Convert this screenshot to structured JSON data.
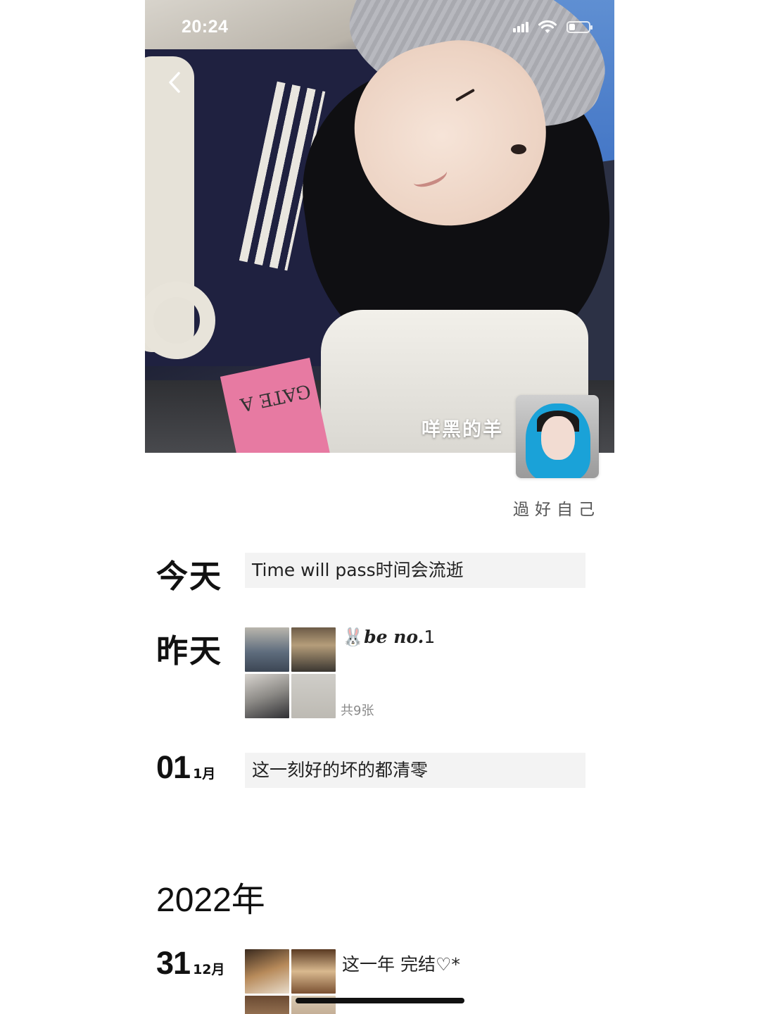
{
  "status_bar": {
    "time": "20:24",
    "battery_level": 0.3
  },
  "cover": {
    "name": "咩黑的羊"
  },
  "profile": {
    "signature": "過好自己"
  },
  "posts": [
    {
      "day": "今天",
      "type": "text",
      "text": "Time will pass时间会流逝"
    },
    {
      "day": "昨天",
      "type": "photos",
      "emoji": "🐰",
      "caption_italic": "be no.",
      "caption_tail": "1",
      "count": "共9张"
    },
    {
      "date": "01",
      "month": "1月",
      "type": "text",
      "text": "这一刻好的坏的都清零"
    }
  ],
  "year_header": "2022年",
  "posts_2022": [
    {
      "date": "31",
      "month": "12月",
      "type": "photos",
      "caption": "这一年 完结♡*"
    }
  ],
  "icons": [
    "back-arrow-icon",
    "signal-icon",
    "wifi-icon",
    "battery-icon"
  ]
}
